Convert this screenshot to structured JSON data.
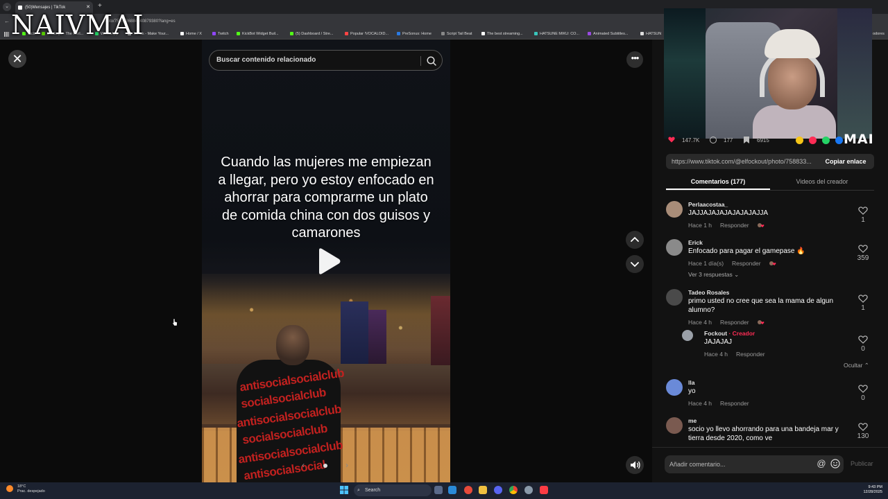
{
  "browser": {
    "tab_title": "(50)Mensajes | TikTok",
    "url": "photo/7588336884040879380?lang=es",
    "bookmarks": [
      {
        "label": "Kick",
        "color": "#53fc18"
      },
      {
        "label": "Duolingo - The worl...",
        "color": "#58cc02"
      },
      {
        "label": "WhatsApp",
        "color": "#25d366"
      },
      {
        "label": "TikTok - Make Your...",
        "color": "#ffffff"
      },
      {
        "label": "Home / X",
        "color": "#ffffff"
      },
      {
        "label": "Twitch",
        "color": "#9146ff"
      },
      {
        "label": "KickBot Widget Buil...",
        "color": "#53fc18"
      },
      {
        "label": "(5) Dashboard / Stre...",
        "color": "#53fc18"
      },
      {
        "label": "Popular !VOCALOID...",
        "color": "#ff4444"
      },
      {
        "label": "PreSonus: Home",
        "color": "#2a7ae2"
      },
      {
        "label": "Script Tail Beat",
        "color": "#888888"
      },
      {
        "label": "The best streaming...",
        "color": "#ffffff"
      },
      {
        "label": "HATSUNE MIKU: CO...",
        "color": "#39c5bb"
      },
      {
        "label": "Animated Subtitles...",
        "color": "#9a4ae2"
      },
      {
        "label": "HATSUN",
        "color": "#dddddd"
      }
    ],
    "bookmarks_overflow": "odores"
  },
  "watermark": "NAIVMAI",
  "viewer": {
    "search_placeholder": "Buscar contenido relacionado",
    "caption": "Cuando las mujeres me empiezan a llegar, pero yo estoy enfocado en ahorrar para comprarme un plato de comida china con dos guisos y camarones",
    "shirt_text": [
      "antisocialsocialclub",
      "socialsocialclub",
      "antisocialsocialclub",
      "socialsocialclub",
      "antisocialsocialclub",
      "antisocialsocial"
    ]
  },
  "panel": {
    "stats": {
      "likes": "147.7K",
      "comments": "177",
      "saves": "6915"
    },
    "mai_logo": "MAI",
    "link": "https://www.tiktok.com/@elfockout/photo/758833...",
    "copy_label": "Copiar enlace",
    "tabs": {
      "comments": "Comentarios (177)",
      "creator_videos": "Videos del creador"
    },
    "reply_label": "Responder",
    "view_replies": "Ver 3 respuestas",
    "hide": "Ocultar",
    "comments": [
      {
        "user": "Perlaacostaa_",
        "text": "JAJJAJAJAJAJAJAJAJJA",
        "time": "Hace 1 h",
        "likes": "1",
        "avatar_color": "#a88c78"
      },
      {
        "user": "Erick",
        "text": "Enfocado para pagar el gamepase 🔥",
        "time": "Hace 1 día(s)",
        "likes": "359",
        "avatar_color": "#8a8a8a"
      },
      {
        "user": "Tadeo Rosales",
        "text": "primo usted no cree que sea la mama de algun alumno?",
        "time": "Hace 4 h",
        "likes": "1",
        "avatar_color": "#4a4a4a"
      },
      {
        "user": "Fockout",
        "creator_tag": "· Creador",
        "text": "JAJAJAJ",
        "time": "Hace 4 h",
        "likes": "0",
        "avatar_color": "#9aa0a8"
      },
      {
        "user": "lla",
        "text": "yo",
        "time": "Hace 4 h",
        "likes": "0",
        "avatar_color": "#6a8ad8"
      },
      {
        "user": "me",
        "text": "socio yo llevo ahorrando para una bandeja mar y tierra desde 2020, como ve",
        "time": "",
        "likes": "130",
        "avatar_color": "#7a5a50"
      }
    ],
    "comment_placeholder": "Añadir comentario...",
    "publish_label": "Publicar"
  },
  "taskbar": {
    "weather_temp": "18°C",
    "weather_desc": "Prac. despejado",
    "search_label": "Search",
    "time": "9:43 PM",
    "date": "12/28/2025"
  },
  "colors": {
    "creator_accent": "#fe2c55",
    "panel_bg": "#121212"
  }
}
